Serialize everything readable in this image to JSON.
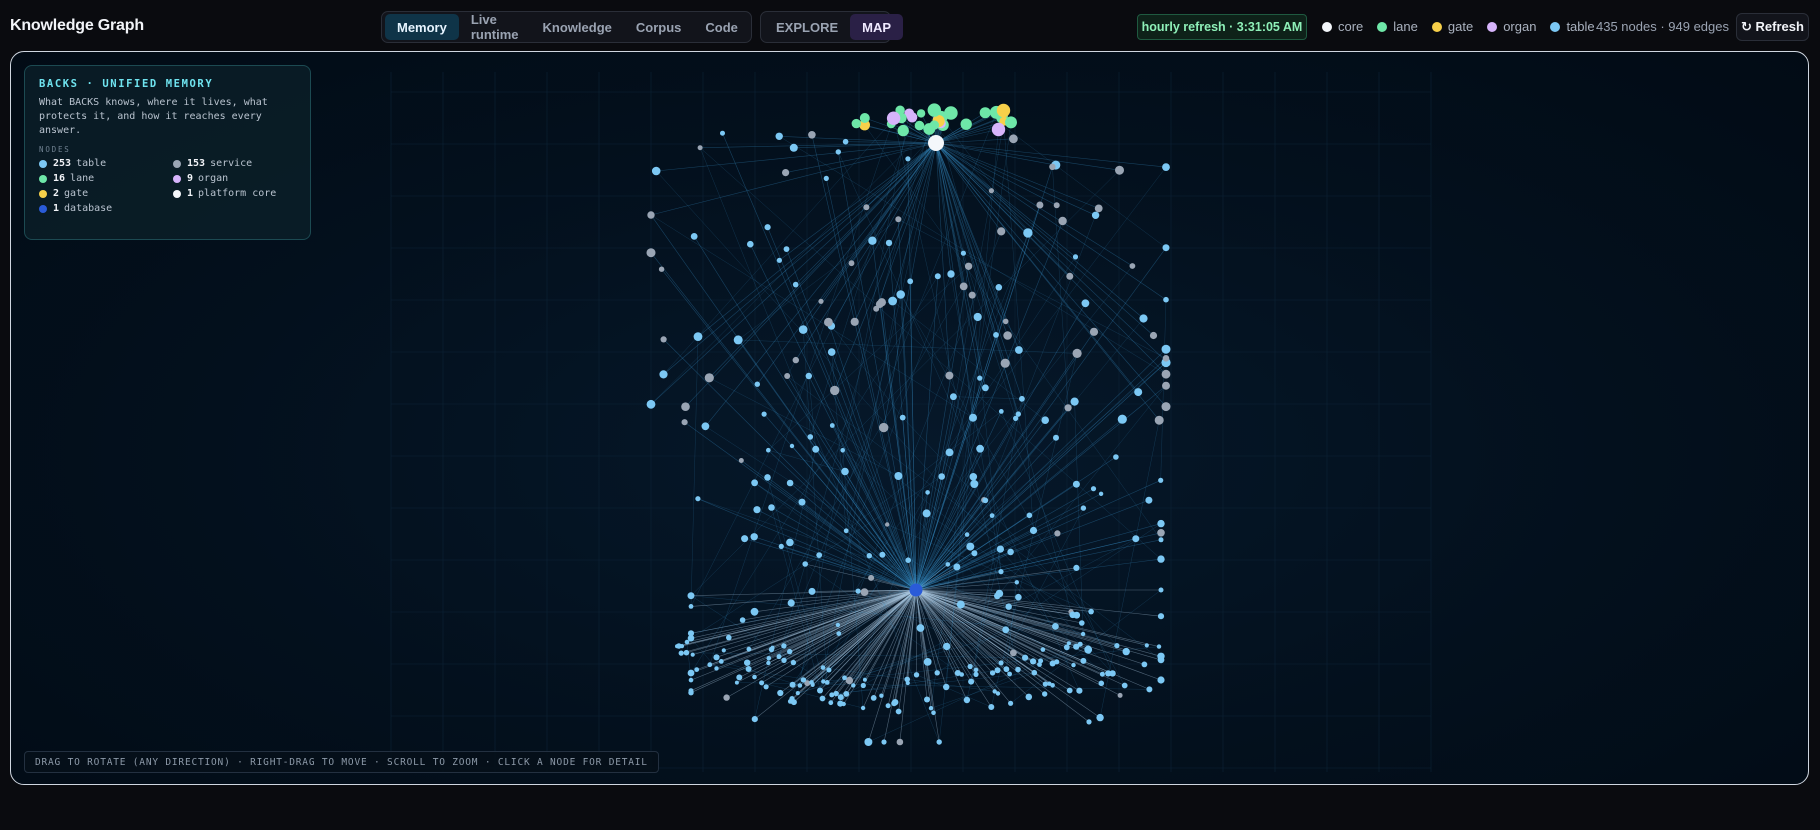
{
  "app": {
    "title": "Knowledge Graph"
  },
  "nav_tabs": [
    {
      "label": "Memory",
      "active": true
    },
    {
      "label": "Live runtime",
      "active": false
    },
    {
      "label": "Knowledge",
      "active": false
    },
    {
      "label": "Corpus",
      "active": false
    },
    {
      "label": "Code",
      "active": false
    }
  ],
  "view_tabs": [
    {
      "label": "EXPLORE",
      "active": false
    },
    {
      "label": "MAP",
      "active": true
    }
  ],
  "refresh_status": "hourly refresh · 3:31:05 AM",
  "legend": [
    {
      "label": "core",
      "color": "#f4f7fb"
    },
    {
      "label": "lane",
      "color": "#6ee7a8"
    },
    {
      "label": "gate",
      "color": "#f7d04a"
    },
    {
      "label": "organ",
      "color": "#d7b4fb"
    },
    {
      "label": "table",
      "color": "#7cc8f4"
    }
  ],
  "counts": "435 nodes · 949 edges",
  "refresh_button": "↻ Refresh",
  "panel": {
    "title": "BACKS · UNIFIED MEMORY",
    "description": "What BACKS knows, where it lives, what protects it, and how it reaches every answer.",
    "subtitle": "NODES",
    "nodes": [
      {
        "count": "253",
        "label": "table",
        "color": "#7cc8f4"
      },
      {
        "count": "153",
        "label": "service",
        "color": "#9aa5b4"
      },
      {
        "count": "16",
        "label": "lane",
        "color": "#6ee7a8"
      },
      {
        "count": "9",
        "label": "organ",
        "color": "#d7b4fb"
      },
      {
        "count": "2",
        "label": "gate",
        "color": "#f7d04a"
      },
      {
        "count": "1",
        "label": "platform core",
        "color": "#f4f7fb"
      },
      {
        "count": "1",
        "label": "database",
        "color": "#2a5bd8"
      }
    ]
  },
  "hint": "DRAG TO ROTATE (ANY DIRECTION) · RIGHT-DRAG TO MOVE · SCROLL TO ZOOM · CLICK A NODE FOR DETAIL",
  "graph_colors": {
    "table": "#7cc8f4",
    "service": "#9aa5b4",
    "lane": "#6ee7a8",
    "organ": "#d7b4fb",
    "gate": "#f7d04a",
    "core": "#f4f7fb",
    "database": "#2a5bd8",
    "edge": "#3d9bd6",
    "edge_light": "#aac7e0"
  }
}
